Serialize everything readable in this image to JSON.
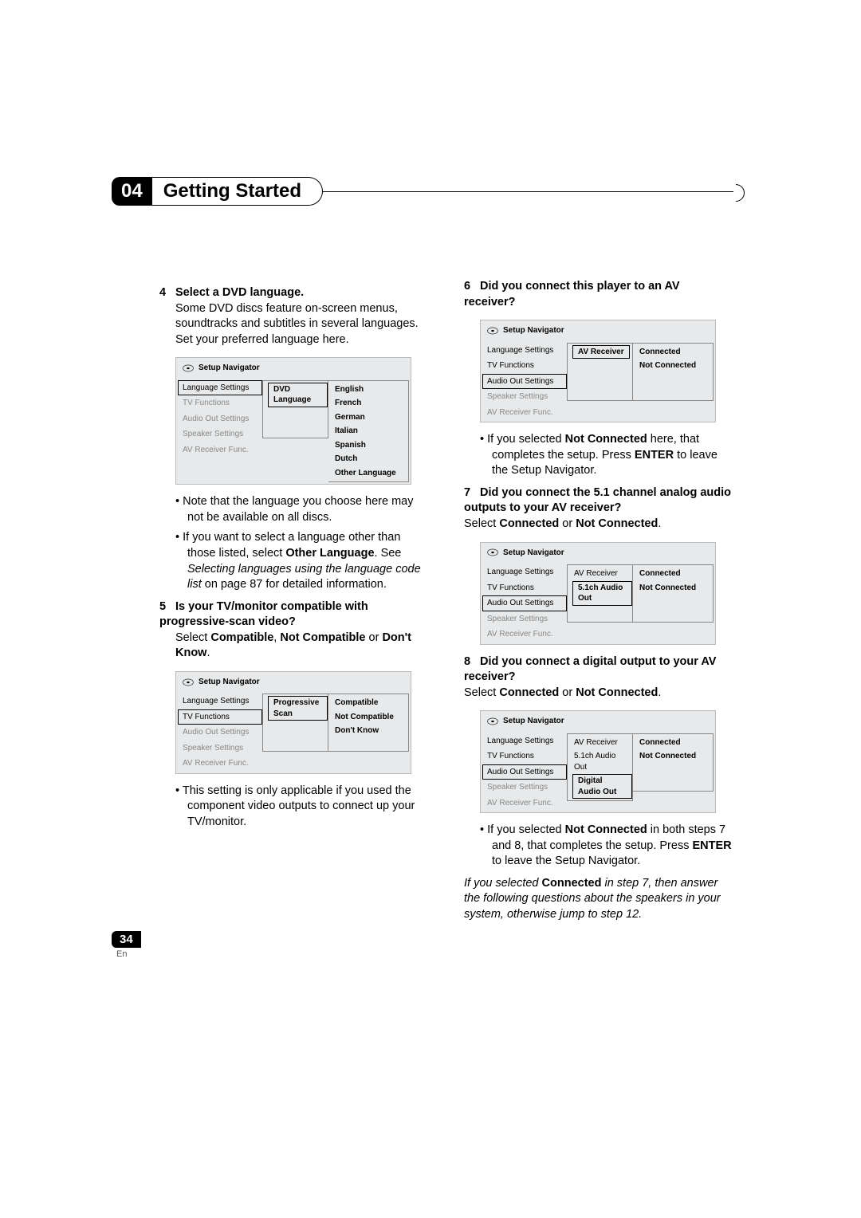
{
  "chapter": {
    "num": "04",
    "title": "Getting Started"
  },
  "page": {
    "num": "34",
    "lang": "En"
  },
  "col_left": {
    "step4": {
      "title": "Select a DVD language.",
      "text": "Some DVD discs feature on-screen menus, soundtracks and subtitles in several languages. Set your preferred language here.",
      "bullet1_a": "Note that the language you choose here may not be available on all discs.",
      "bullet2_a": "If you want to select a language other than those listed, select ",
      "bullet2_b": "Other Language",
      "bullet2_c": ". See ",
      "bullet2_d": "Selecting languages using the language code list",
      "bullet2_e": " on page 87 for detailed information."
    },
    "step5": {
      "title": "Is your TV/monitor compatible with progressive-scan video?",
      "text_a": "Select ",
      "text_b": "Compatible",
      "text_c": ", ",
      "text_d": "Not Compatible",
      "text_e": " or ",
      "text_f": "Don't Know",
      "text_g": ".",
      "bullet1": "This setting is only applicable if you used the component video outputs to connect up your TV/monitor."
    }
  },
  "col_right": {
    "step6": {
      "title": "Did you connect this player to an AV receiver?",
      "bullet1_a": "If you selected ",
      "bullet1_b": "Not Connected",
      "bullet1_c": " here, that completes the setup. Press ",
      "bullet1_d": "ENTER",
      "bullet1_e": " to leave the Setup Navigator."
    },
    "step7": {
      "title": "Did you connect the 5.1 channel analog audio outputs to your AV receiver?",
      "text_a": "Select ",
      "text_b": "Connected",
      "text_c": " or ",
      "text_d": "Not Connected",
      "text_e": "."
    },
    "step8": {
      "title": "Did you connect a digital output to your AV receiver?",
      "text_a": "Select ",
      "text_b": "Connected",
      "text_c": " or ",
      "text_d": "Not Connected",
      "text_e": ".",
      "bullet1_a": "If you selected ",
      "bullet1_b": "Not Connected",
      "bullet1_c": " in both steps 7 and 8, that completes the setup. Press ",
      "bullet1_d": "ENTER",
      "bullet1_e": " to leave the Setup Navigator.",
      "tail_a": "If you selected ",
      "tail_b": "Connected",
      "tail_c": " in step 7, then answer the following questions about the speakers in your system, otherwise jump to step 12."
    }
  },
  "setup_title": "Setup Navigator",
  "menu_items": {
    "lang": "Language Settings",
    "tv": "TV Functions",
    "audio": "Audio Out Settings",
    "spk": "Speaker Settings",
    "avr": "AV Receiver Func."
  },
  "menu1": {
    "center": "DVD Language",
    "opts": [
      "English",
      "French",
      "German",
      "Italian",
      "Spanish",
      "Dutch",
      "Other Language"
    ]
  },
  "menu2": {
    "center": "Progressive Scan",
    "opts": [
      "Compatible",
      "Not Compatible",
      "Don't Know"
    ]
  },
  "menu3": {
    "center": "AV Receiver",
    "opts": [
      "Connected",
      "Not Connected"
    ]
  },
  "menu4": {
    "center1": "AV Receiver",
    "center2": "5.1ch Audio Out",
    "opts": [
      "Connected",
      "Not Connected"
    ]
  },
  "menu5": {
    "center1": "AV Receiver",
    "center2": "5.1ch Audio Out",
    "center3": "Digital Audio Out",
    "opts": [
      "Connected",
      "Not Connected"
    ]
  }
}
